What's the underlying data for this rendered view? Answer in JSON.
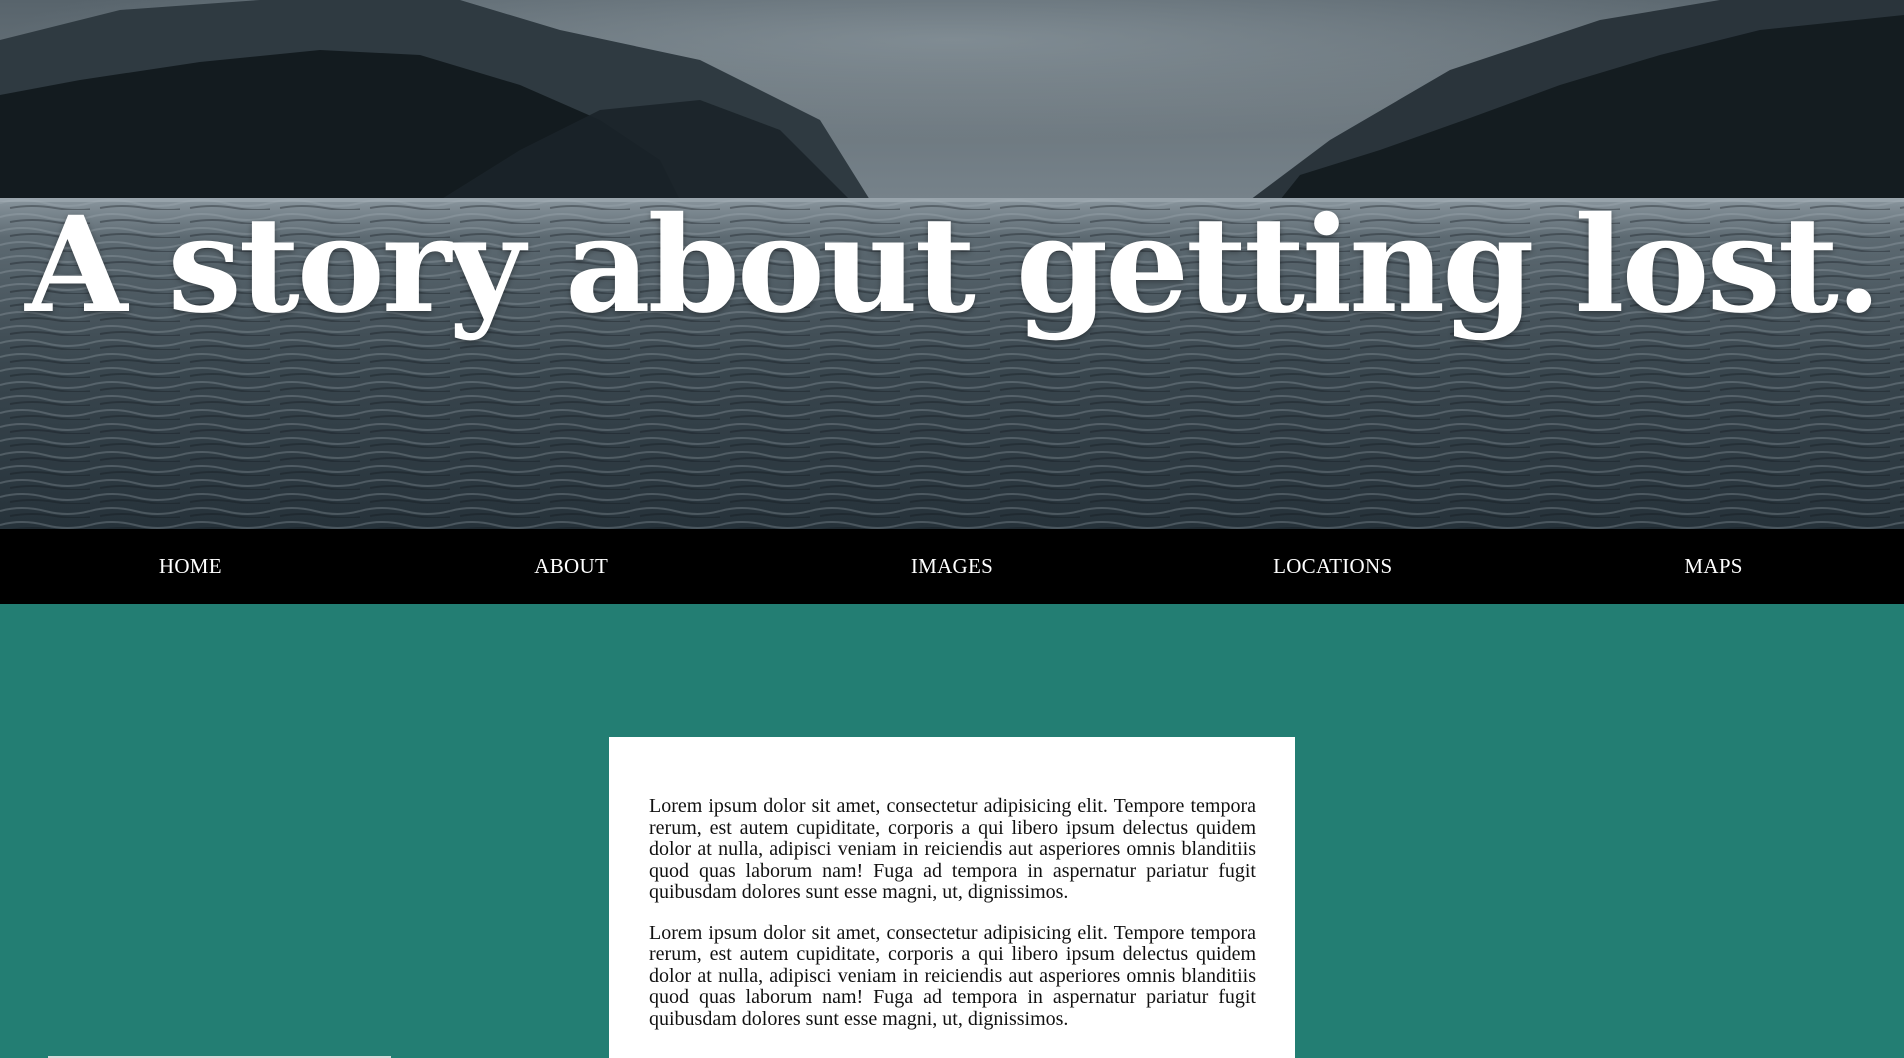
{
  "hero": {
    "title": "A story about getting lost."
  },
  "nav": {
    "items": [
      {
        "label": "HOME"
      },
      {
        "label": "ABOUT"
      },
      {
        "label": "IMAGES"
      },
      {
        "label": "LOCATIONS"
      },
      {
        "label": "MAPS"
      }
    ]
  },
  "content": {
    "paragraphs": [
      "Lorem ipsum dolor sit amet, consectetur adipisicing elit. Tempore tempora rerum, est autem cupiditate, corporis a qui libero ipsum delectus quidem dolor at nulla, adipisci veniam in reiciendis aut asperiores omnis blanditiis quod quas laborum nam! Fuga ad tempora in aspernatur pariatur fugit quibusdam dolores sunt esse magni, ut, dignissimos.",
      "Lorem ipsum dolor sit amet, consectetur adipisicing elit. Tempore tempora rerum, est autem cupiditate, corporis a qui libero ipsum delectus quidem dolor at nulla, adipisci veniam in reiciendis aut asperiores omnis blanditiis quod quas laborum nam! Fuga ad tempora in aspernatur pariatur fugit quibusdam dolores sunt esse magni, ut, dignissimos."
    ]
  },
  "colors": {
    "background": "#237e73",
    "nav": "#000000",
    "card": "#ffffff",
    "hero_text": "#ffffff"
  }
}
